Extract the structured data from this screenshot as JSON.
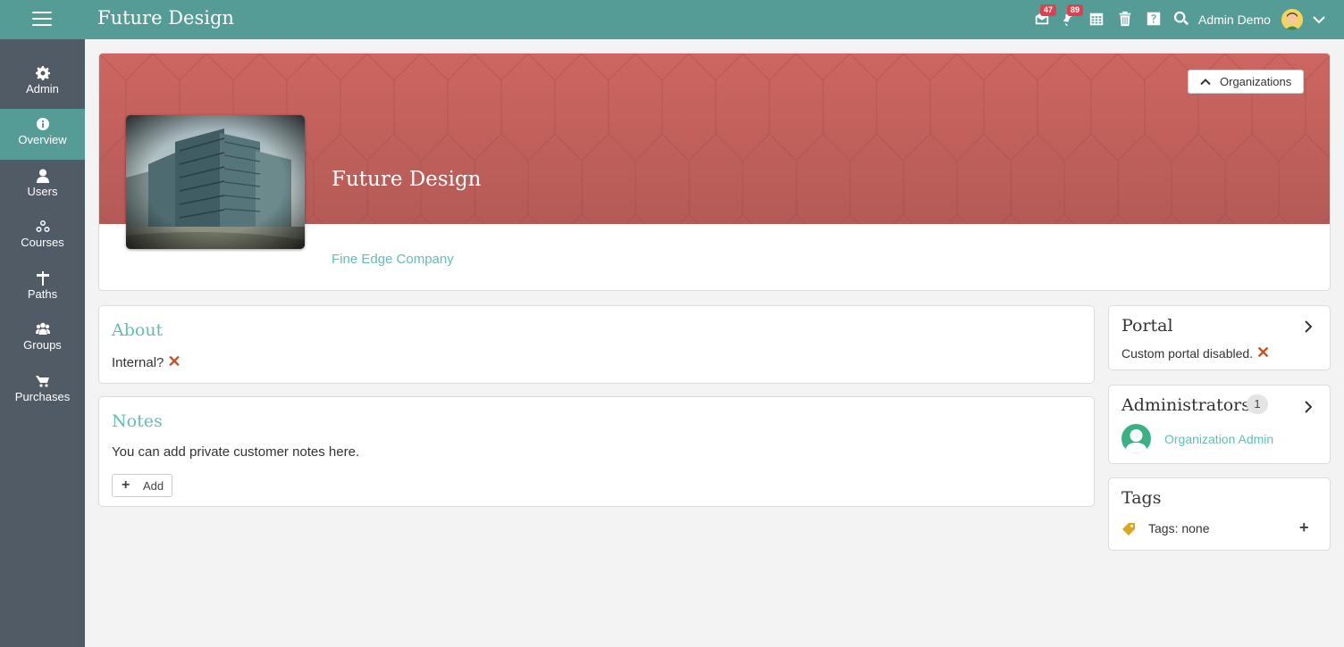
{
  "header": {
    "title": "Future Design",
    "messages_count": "47",
    "notifications_count": "89",
    "user_name": "Admin Demo"
  },
  "sidebar": {
    "items": [
      {
        "label": "Admin",
        "icon": "gear-icon"
      },
      {
        "label": "Overview",
        "icon": "info-icon"
      },
      {
        "label": "Users",
        "icon": "user-icon"
      },
      {
        "label": "Courses",
        "icon": "courses-icon"
      },
      {
        "label": "Paths",
        "icon": "signpost-icon"
      },
      {
        "label": "Groups",
        "icon": "group-icon"
      },
      {
        "label": "Purchases",
        "icon": "cart-icon"
      }
    ],
    "active": "Overview"
  },
  "banner": {
    "org_name": "Future Design",
    "subtitle": "Fine Edge Company",
    "organizations_button": "Organizations"
  },
  "about": {
    "title": "About",
    "internal_label": "Internal?",
    "internal_mark": "✕"
  },
  "notes": {
    "title": "Notes",
    "text": "You can add private customer notes here.",
    "add_label": "Add"
  },
  "portal": {
    "title": "Portal",
    "status": "Custom portal disabled.",
    "status_mark": "✕"
  },
  "administrators": {
    "title": "Administrators",
    "count": "1",
    "admin_name": "Organization Admin"
  },
  "tags": {
    "title": "Tags",
    "text": "Tags: none",
    "add_mark": "+"
  },
  "colors": {
    "topbar": "#569c96",
    "sidebar": "#515b66",
    "banner": "#c2605c",
    "accent": "#63bdb5",
    "danger": "#c5532b"
  }
}
